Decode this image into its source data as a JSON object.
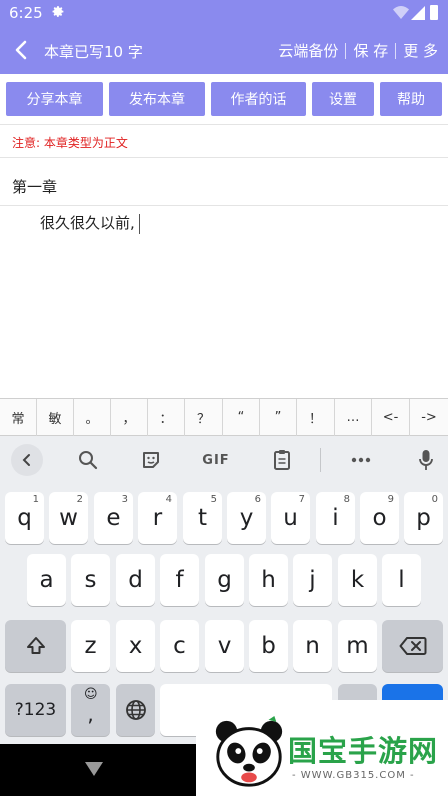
{
  "status_bar": {
    "time": "6:25",
    "icons": [
      "gear-icon",
      "wifi-icon",
      "signal-icon",
      "battery-icon"
    ]
  },
  "title_bar": {
    "title": "本章已写10 字",
    "menu": [
      "云端备份",
      "保 存",
      "更 多"
    ]
  },
  "actions": [
    "分享本章",
    "发布本章",
    "作者的话",
    "设置",
    "帮助"
  ],
  "notice": "注意: 本章类型为正文",
  "chapter_title": "第一章",
  "editor_text": "很久很久以前,",
  "symbols": [
    "常",
    "敏",
    "。",
    "，",
    "：",
    "？",
    "“",
    "”",
    "！",
    "…",
    "<-",
    "->"
  ],
  "keyboard": {
    "toolbar": [
      "back-icon",
      "search-icon",
      "sticker-icon",
      "GIF",
      "clipboard-icon",
      "more-icon",
      "mic-icon"
    ],
    "row1": [
      [
        "q",
        "1"
      ],
      [
        "w",
        "2"
      ],
      [
        "e",
        "3"
      ],
      [
        "r",
        "4"
      ],
      [
        "t",
        "5"
      ],
      [
        "y",
        "6"
      ],
      [
        "u",
        "7"
      ],
      [
        "i",
        "8"
      ],
      [
        "o",
        "9"
      ],
      [
        "p",
        "0"
      ]
    ],
    "row2": [
      "a",
      "s",
      "d",
      "f",
      "g",
      "h",
      "j",
      "k",
      "l"
    ],
    "row3": [
      "z",
      "x",
      "c",
      "v",
      "b",
      "n",
      "m"
    ],
    "symbols_key": "?123",
    "comma_key": ","
  },
  "watermark": {
    "text": "国宝手游网",
    "url": "- WWW.GB315.COM -"
  },
  "colors": {
    "accent": "#8a8aee",
    "notice": "#e02020",
    "keyboard_bg": "#eceef1",
    "key_blue": "#1a73e8"
  }
}
